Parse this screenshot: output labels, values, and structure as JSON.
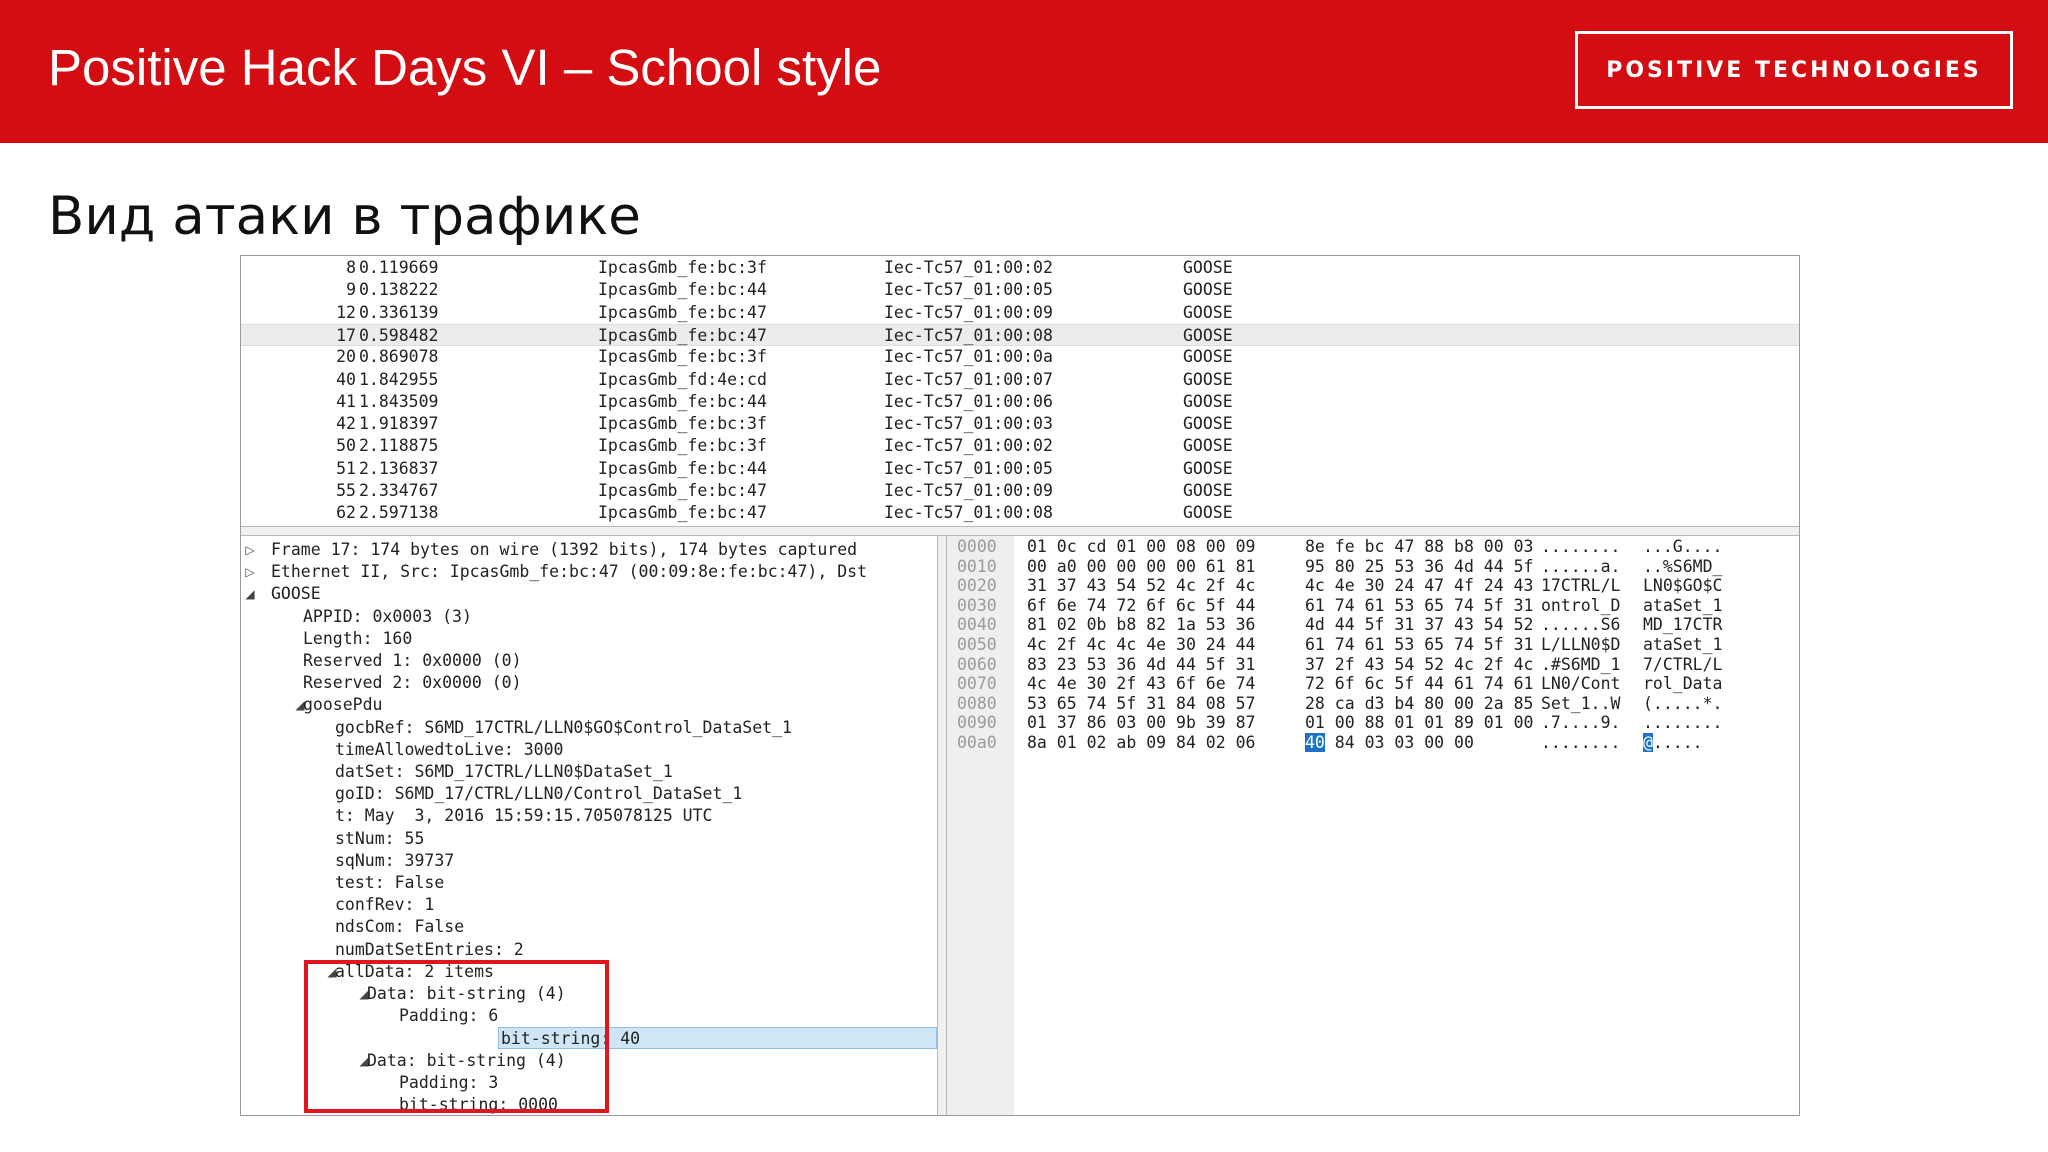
{
  "header": {
    "title": "Positive Hack Days VI – School style",
    "logo_text": "POSITIVE TECHNOLOGIES",
    "colors": {
      "banner": "#d40d12",
      "annotation_box": "#e0151d",
      "selection": "#cfe6f6",
      "hex_highlight": "#1e73c8"
    }
  },
  "slide": {
    "title": "Вид атаки в трафике"
  },
  "packet_list": {
    "rows": [
      {
        "no": "8",
        "time": "0.119669",
        "source": "IpcasGmb_fe:bc:3f",
        "destination": "Iec-Tc57_01:00:02",
        "protocol": "GOOSE"
      },
      {
        "no": "9",
        "time": "0.138222",
        "source": "IpcasGmb_fe:bc:44",
        "destination": "Iec-Tc57_01:00:05",
        "protocol": "GOOSE"
      },
      {
        "no": "12",
        "time": "0.336139",
        "source": "IpcasGmb_fe:bc:47",
        "destination": "Iec-Tc57_01:00:09",
        "protocol": "GOOSE"
      },
      {
        "no": "17",
        "time": "0.598482",
        "source": "IpcasGmb_fe:bc:47",
        "destination": "Iec-Tc57_01:00:08",
        "protocol": "GOOSE",
        "selected": true
      },
      {
        "no": "20",
        "time": "0.869078",
        "source": "IpcasGmb_fe:bc:3f",
        "destination": "Iec-Tc57_01:00:0a",
        "protocol": "GOOSE"
      },
      {
        "no": "40",
        "time": "1.842955",
        "source": "IpcasGmb_fd:4e:cd",
        "destination": "Iec-Tc57_01:00:07",
        "protocol": "GOOSE"
      },
      {
        "no": "41",
        "time": "1.843509",
        "source": "IpcasGmb_fe:bc:44",
        "destination": "Iec-Tc57_01:00:06",
        "protocol": "GOOSE"
      },
      {
        "no": "42",
        "time": "1.918397",
        "source": "IpcasGmb_fe:bc:3f",
        "destination": "Iec-Tc57_01:00:03",
        "protocol": "GOOSE"
      },
      {
        "no": "50",
        "time": "2.118875",
        "source": "IpcasGmb_fe:bc:3f",
        "destination": "Iec-Tc57_01:00:02",
        "protocol": "GOOSE"
      },
      {
        "no": "51",
        "time": "2.136837",
        "source": "IpcasGmb_fe:bc:44",
        "destination": "Iec-Tc57_01:00:05",
        "protocol": "GOOSE"
      },
      {
        "no": "55",
        "time": "2.334767",
        "source": "IpcasGmb_fe:bc:47",
        "destination": "Iec-Tc57_01:00:09",
        "protocol": "GOOSE"
      },
      {
        "no": "62",
        "time": "2.597138",
        "source": "IpcasGmb_fe:bc:47",
        "destination": "Iec-Tc57_01:00:08",
        "protocol": "GOOSE"
      }
    ]
  },
  "details": {
    "rows": [
      {
        "text": "Frame 17: 174 bytes on wire (1392 bits), 174 bytes captured",
        "level": 0,
        "expander": "collapsed"
      },
      {
        "text": "Ethernet II, Src: IpcasGmb_fe:bc:47 (00:09:8e:fe:bc:47), Dst",
        "level": 0,
        "expander": "collapsed"
      },
      {
        "text": "GOOSE",
        "level": 0,
        "expander": "expanded"
      },
      {
        "text": "APPID: 0x0003 (3)",
        "level": 1
      },
      {
        "text": "Length: 160",
        "level": 1
      },
      {
        "text": "Reserved 1: 0x0000 (0)",
        "level": 1
      },
      {
        "text": "Reserved 2: 0x0000 (0)",
        "level": 1
      },
      {
        "text": "goosePdu",
        "level": 1,
        "expander": "expanded"
      },
      {
        "text": "gocbRef: S6MD_17CTRL/LLN0$GO$Control_DataSet_1",
        "level": 2
      },
      {
        "text": "timeAllowedtoLive: 3000",
        "level": 2
      },
      {
        "text": "datSet: S6MD_17CTRL/LLN0$DataSet_1",
        "level": 2
      },
      {
        "text": "goID: S6MD_17/CTRL/LLN0/Control_DataSet_1",
        "level": 2
      },
      {
        "text": "t: May  3, 2016 15:59:15.705078125 UTC",
        "level": 2
      },
      {
        "text": "stNum: 55",
        "level": 2
      },
      {
        "text": "sqNum: 39737",
        "level": 2
      },
      {
        "text": "test: False",
        "level": 2
      },
      {
        "text": "confRev: 1",
        "level": 2
      },
      {
        "text": "ndsCom: False",
        "level": 2
      },
      {
        "text": "numDatSetEntries: 2",
        "level": 2
      },
      {
        "text": "allData: 2 items",
        "level": 2,
        "expander": "expanded"
      },
      {
        "text": "Data: bit-string (4)",
        "level": 3,
        "expander": "expanded"
      },
      {
        "text": "Padding: 6",
        "level": 4
      },
      {
        "text": "bit-string: 40",
        "level": 4,
        "selected": true
      },
      {
        "text": "Data: bit-string (4)",
        "level": 3,
        "expander": "expanded"
      },
      {
        "text": "Padding: 3",
        "level": 4
      },
      {
        "text": "bit-string: 0000",
        "level": 4
      }
    ]
  },
  "hexdump": {
    "rows": [
      {
        "offset": "0000",
        "bytes1": "01 0c cd 01 00 08 00 09",
        "bytes2": "8e fe bc 47 88 b8 00 03",
        "ascii1": "........",
        "ascii2": "...G...."
      },
      {
        "offset": "0010",
        "bytes1": "00 a0 00 00 00 00 61 81",
        "bytes2": "95 80 25 53 36 4d 44 5f",
        "ascii1": "......a.",
        "ascii2": "..%S6MD_"
      },
      {
        "offset": "0020",
        "bytes1": "31 37 43 54 52 4c 2f 4c",
        "bytes2": "4c 4e 30 24 47 4f 24 43",
        "ascii1": "17CTRL/L",
        "ascii2": "LN0$GO$C"
      },
      {
        "offset": "0030",
        "bytes1": "6f 6e 74 72 6f 6c 5f 44",
        "bytes2": "61 74 61 53 65 74 5f 31",
        "ascii1": "ontrol_D",
        "ascii2": "ataSet_1"
      },
      {
        "offset": "0040",
        "bytes1": "81 02 0b b8 82 1a 53 36",
        "bytes2": "4d 44 5f 31 37 43 54 52",
        "ascii1": "......S6",
        "ascii2": "MD_17CTR"
      },
      {
        "offset": "0050",
        "bytes1": "4c 2f 4c 4c 4e 30 24 44",
        "bytes2": "61 74 61 53 65 74 5f 31",
        "ascii1": "L/LLN0$D",
        "ascii2": "ataSet_1"
      },
      {
        "offset": "0060",
        "bytes1": "83 23 53 36 4d 44 5f 31",
        "bytes2": "37 2f 43 54 52 4c 2f 4c",
        "ascii1": ".#S6MD_1",
        "ascii2": "7/CTRL/L"
      },
      {
        "offset": "0070",
        "bytes1": "4c 4e 30 2f 43 6f 6e 74",
        "bytes2": "72 6f 6c 5f 44 61 74 61",
        "ascii1": "LN0/Cont",
        "ascii2": "rol_Data"
      },
      {
        "offset": "0080",
        "bytes1": "53 65 74 5f 31 84 08 57",
        "bytes2": "28 ca d3 b4 80 00 2a 85",
        "ascii1": "Set_1..W",
        "ascii2": "(.....*."
      },
      {
        "offset": "0090",
        "bytes1": "01 37 86 03 00 9b 39 87",
        "bytes2": "01 00 88 01 01 89 01 00",
        "ascii1": ".7....9.",
        "ascii2": "........"
      },
      {
        "offset": "00a0",
        "bytes1": "8a 01 02 ab 09 84 02 06",
        "bytes2": "40 84 03 03 00 00",
        "ascii1": "........",
        "ascii2": "@.....",
        "highlight_byte": "40",
        "highlight_ascii": "@"
      }
    ]
  }
}
